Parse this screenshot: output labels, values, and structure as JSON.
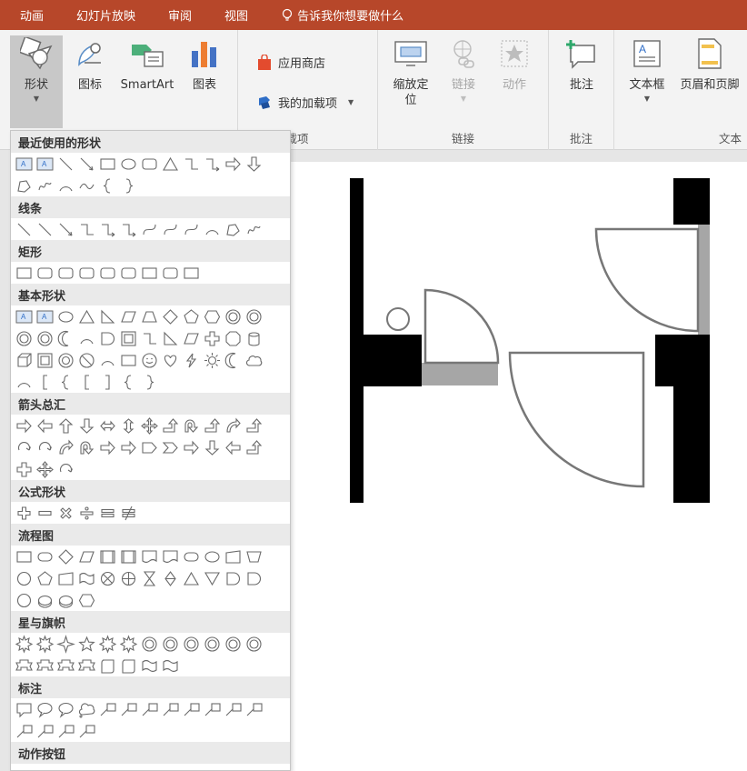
{
  "tabs": [
    "动画",
    "幻灯片放映",
    "审阅",
    "视图"
  ],
  "tell_me": "告诉我你想要做什么",
  "ribbon": {
    "illustrations": {
      "shapes": "形状",
      "icons": "图标",
      "smartart": "SmartArt",
      "chart": "图表"
    },
    "addins": {
      "store": "应用商店",
      "my_addins": "我的加载项",
      "label": "加载项"
    },
    "links": {
      "zoom": "缩放定位",
      "link": "链接",
      "action": "动作",
      "label": "链接"
    },
    "comments": {
      "comment": "批注",
      "label": "批注"
    },
    "text": {
      "textbox": "文本框",
      "header_footer": "页眉和页脚",
      "label": "文本"
    }
  },
  "shapes_panel": {
    "categories": [
      {
        "title": "最近使用的形状"
      },
      {
        "title": "线条"
      },
      {
        "title": "矩形"
      },
      {
        "title": "基本形状"
      },
      {
        "title": "箭头总汇"
      },
      {
        "title": "公式形状"
      },
      {
        "title": "流程图"
      },
      {
        "title": "星与旗帜"
      },
      {
        "title": "标注"
      },
      {
        "title": "动作按钮"
      }
    ]
  },
  "colors": {
    "accent": "#b7472a",
    "wall": "#000000",
    "door_stroke": "#777777",
    "door_gray": "#a6a6a6"
  }
}
